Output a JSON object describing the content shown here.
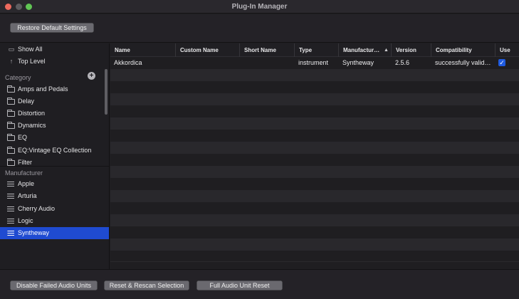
{
  "window": {
    "title": "Plug-In Manager"
  },
  "toolbar": {
    "restore_label": "Restore Default Settings"
  },
  "sidebar": {
    "top_items": [
      {
        "label": "Show All",
        "icon": "tray-icon"
      },
      {
        "label": "Top Level",
        "icon": "arrow-up-icon"
      }
    ],
    "category_header": "Category",
    "categories": [
      "Amps and Pedals",
      "Delay",
      "Distortion",
      "Dynamics",
      "EQ",
      "EQ:Vintage EQ Collection",
      "Filter"
    ],
    "manufacturer_header": "Manufacturer",
    "manufacturers": [
      "Apple",
      "Arturia",
      "Cherry Audio",
      "Logic",
      "Syntheway"
    ],
    "selected_manufacturer": "Syntheway"
  },
  "table": {
    "columns": [
      "Name",
      "Custom Name",
      "Short Name",
      "Type",
      "Manufactur…",
      "Version",
      "Compatibility",
      "Use"
    ],
    "sort_column": "Manufactur…",
    "rows": [
      {
        "name": "Akkordica",
        "custom_name": "",
        "short_name": "",
        "type": "instrument",
        "manufacturer": "Syntheway",
        "version": "2.5.6",
        "compatibility": "successfully valid…",
        "use": true
      }
    ]
  },
  "footer": {
    "disable_label": "Disable Failed Audio Units",
    "rescan_label": "Reset & Rescan Selection",
    "full_reset_label": "Full Audio Unit Reset"
  },
  "colors": {
    "selection": "#1f4bd1",
    "checkbox": "#1f5be0"
  }
}
